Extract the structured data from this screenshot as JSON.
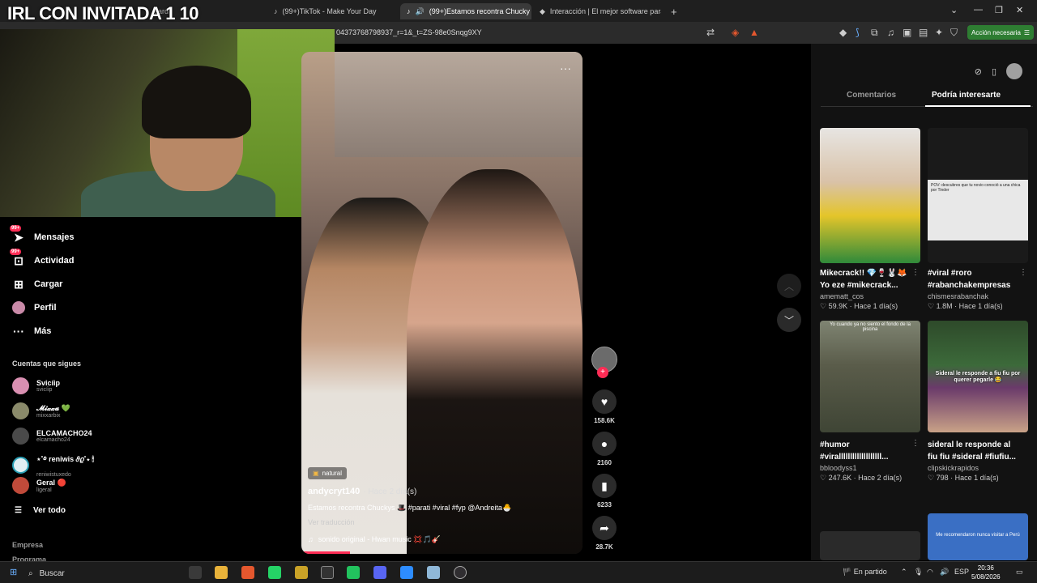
{
  "stream_overlay": {
    "title": "IRL CON INVITADA 1 10"
  },
  "browser": {
    "tabs": [
      {
        "label": "(99+)TikTok - Make Your Day",
        "active": false
      },
      {
        "label": "(99+)Estamos recontra Chucky",
        "active": true
      },
      {
        "label": "Interacción | El mejor software para p",
        "active": false
      }
    ],
    "hidden_tab_fragment": "eard",
    "url": "04373768798937_r=1&_t=ZS-98e0Snqg9XY",
    "action_button": "Acción necesaria"
  },
  "sidebar": {
    "nav": [
      {
        "label": "Mensajes",
        "icon": "send-icon",
        "badge": "99+"
      },
      {
        "label": "Actividad",
        "icon": "inbox-icon",
        "badge": "99+"
      },
      {
        "label": "Cargar",
        "icon": "upload-icon"
      },
      {
        "label": "Perfil",
        "icon": "profile-icon"
      },
      {
        "label": "Más",
        "icon": "more-icon"
      }
    ],
    "following_title": "Cuentas que sigues",
    "following": [
      {
        "name": "Svicíip",
        "handle": "svicíip",
        "color": "#d98fb1"
      },
      {
        "name": "𝓜𝓲𝔁𝔁𝓪 💚",
        "handle": "mixxarbix",
        "color": "#8a8a6a"
      },
      {
        "name": "ELCAMACHO24",
        "handle": "elcamacho24",
        "color": "#4a4a4a"
      },
      {
        "name": "⋆˚࿔ reniwis 𝜗𝜚˚⋆ 🕯",
        "handle": "reniwistuxedo",
        "color": "#e0eef2"
      },
      {
        "name": "Geral 🔴",
        "handle": "ligeral",
        "color": "#c04a3a"
      }
    ],
    "see_all": "Ver todo",
    "footer": [
      "Empresa",
      "Programa"
    ]
  },
  "video": {
    "tag": "natural",
    "author": "andycryt140",
    "ago": "· Hace 2 día(s)",
    "description": "Estamos recontra Chuckys 🎩 #parati #viral #fyp @Andreita🐣",
    "translate": "Ver traducción",
    "sound": "sonido original - Hwan music 💢🎵🎸"
  },
  "actions": {
    "likes": "158.6K",
    "comments": "2160",
    "saves": "6233",
    "shares": "28.7K"
  },
  "right_panel": {
    "tabs": [
      "Comentarios",
      "Podría interesarte"
    ],
    "active_tab": 1,
    "cards": [
      {
        "title": "Mikecrack!! 💎🍷🐰🦊",
        "title2": "Yo eze #mikecrack...",
        "author": "amematt_cos",
        "likes": "59.9K",
        "ago": "Hace 1 día(s)",
        "thumb_text": ""
      },
      {
        "title": "#viral #roro",
        "title2": "#rabanchakempresas",
        "author": "chismesrabanchak",
        "likes": "1.8M",
        "ago": "Hace 1 día(s)",
        "thumb_text": "POV: descubres que tu novio conoció a una chica por Tinder"
      },
      {
        "title": "#humor",
        "title2": "#viralllllllllllllllllll...",
        "author": "bbloodyss1",
        "likes": "247.6K",
        "ago": "Hace 2 día(s)",
        "thumb_text": "Yo cuando ya no siento el fondo de la piscina"
      },
      {
        "title": "sideral le responde al",
        "title2": "fiu fiu #sideral #fiufiu...",
        "author": "clipskickrapidos",
        "likes": "798",
        "ago": "Hace 1 día(s)",
        "thumb_text": "Sideral le responde a fiu fiu por querer pegarle 😂"
      }
    ],
    "bottom_thumb_text": "Me recomendaron nunca visitar a Perú"
  },
  "taskbar": {
    "search": "Buscar",
    "network": "En partido",
    "lang": "ESP",
    "time": "20:36",
    "date": "5/08/2026"
  }
}
